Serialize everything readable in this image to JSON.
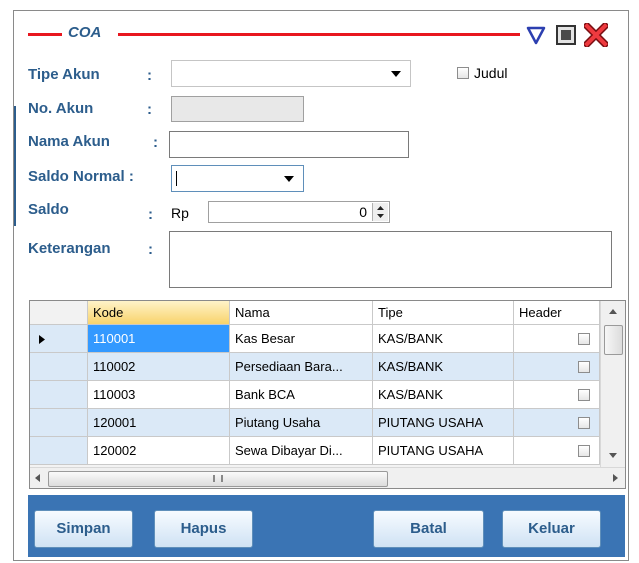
{
  "window": {
    "title": "COA"
  },
  "form": {
    "tipe_akun_label": "Tipe Akun",
    "judul_label": "Judul",
    "no_akun_label": "No. Akun",
    "nama_akun_label": "Nama Akun",
    "saldo_normal_label": "Saldo Normal :",
    "saldo_label": "Saldo",
    "currency": "Rp",
    "saldo_value": "0",
    "keterangan_label": "Keterangan",
    "colon": ":"
  },
  "grid": {
    "columns": [
      "Kode",
      "Nama",
      "Tipe",
      "Header"
    ],
    "rows": [
      {
        "kode": "110001",
        "nama": "Kas Besar",
        "tipe": "KAS/BANK",
        "header": false
      },
      {
        "kode": "110002",
        "nama": "Persediaan Bara...",
        "tipe": "KAS/BANK",
        "header": false
      },
      {
        "kode": "110003",
        "nama": "Bank BCA",
        "tipe": "KAS/BANK",
        "header": false
      },
      {
        "kode": "120001",
        "nama": "Piutang Usaha",
        "tipe": "PIUTANG USAHA",
        "header": false
      },
      {
        "kode": "120002",
        "nama": "Sewa Dibayar Di...",
        "tipe": "PIUTANG USAHA",
        "header": false
      }
    ]
  },
  "buttons": {
    "simpan": "Simpan",
    "hapus": "Hapus",
    "batal": "Batal",
    "keluar": "Keluar"
  },
  "colors": {
    "accent": "#e8171f",
    "label": "#2c5d8c",
    "button_bar": "#3a74b4",
    "selected": "#3399ff"
  }
}
